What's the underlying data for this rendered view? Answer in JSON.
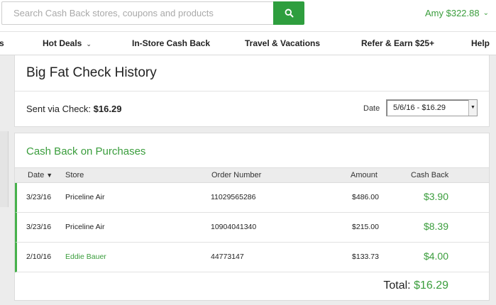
{
  "header": {
    "search": {
      "placeholder": "Search Cash Back stores, coupons and products",
      "value": ""
    },
    "account_label": "Amy $322.88",
    "account_chevron": "chevron-down-icon"
  },
  "nav": {
    "items": [
      {
        "label": "s"
      },
      {
        "label": "Hot Deals",
        "has_dropdown": true
      },
      {
        "label": "In-Store Cash Back"
      },
      {
        "label": "Travel & Vacations"
      },
      {
        "label": "Refer & Earn $25+"
      },
      {
        "label": "Help"
      }
    ]
  },
  "history": {
    "title": "Big Fat Check History",
    "sent_label": "Sent via Check:",
    "sent_amount": "$16.29",
    "date_label": "Date",
    "date_selected": "5/6/16 - $16.29"
  },
  "purchases": {
    "title": "Cash Back on Purchases",
    "columns": {
      "date": "Date",
      "store": "Store",
      "order": "Order Number",
      "amount": "Amount",
      "cashback": "Cash Back"
    },
    "rows": [
      {
        "date": "3/23/16",
        "store": "Priceline Air",
        "order": "11029565286",
        "amount": "$486.00",
        "cashback": "$3.90"
      },
      {
        "date": "3/23/16",
        "store": "Priceline Air",
        "order": "10904041340",
        "amount": "$215.00",
        "cashback": "$8.39"
      },
      {
        "date": "2/10/16",
        "store": "Eddie Bauer",
        "order": "44773147",
        "amount": "$133.73",
        "cashback": "$4.00"
      }
    ],
    "total_label": "Total:",
    "total_value": "$16.29"
  },
  "colors": {
    "accent_green": "#3a9d3c",
    "search_button": "#2e9e3e"
  }
}
